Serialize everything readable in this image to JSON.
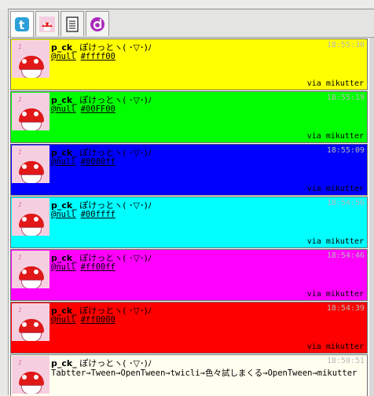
{
  "tabs": [
    {
      "name": "twitter-tab",
      "icon": "twitter-icon",
      "color": "#2a9fd8",
      "active": true
    },
    {
      "name": "mentions-tab",
      "icon": "avatar-icon",
      "color": "#cc2222",
      "active": false
    },
    {
      "name": "list-tab",
      "icon": "notepad-icon",
      "color": "#444444",
      "active": false
    },
    {
      "name": "activity-tab",
      "icon": "d-icon",
      "color": "#aa2bbb",
      "active": false
    }
  ],
  "tweets": [
    {
      "screen_name": "p_ck_",
      "display_name": "ぽけっとヽ( ･▽･)ﾉ",
      "time": "18:55:30",
      "mention": "@null",
      "tag": "#ffff00",
      "bg": "#ffff00",
      "via": "via mikutter"
    },
    {
      "screen_name": "p_ck_",
      "display_name": "ぽけっとヽ( ･▽･)ﾉ",
      "time": "18:55:19",
      "mention": "@null",
      "tag": "#00FF00",
      "bg": "#00ff00",
      "via": "via mikutter"
    },
    {
      "screen_name": "p_ck_",
      "display_name": "ぽけっとヽ( ･▽･)ﾉ",
      "time": "18:55:09",
      "mention": "@null",
      "tag": "#0000ff",
      "bg": "#0000ff",
      "via": "via mikutter"
    },
    {
      "screen_name": "p_ck_",
      "display_name": "ぽけっとヽ( ･▽･)ﾉ",
      "time": "18:54:56",
      "mention": "@null",
      "tag": "#00ffff",
      "bg": "#00ffff",
      "via": "via mikutter"
    },
    {
      "screen_name": "p_ck_",
      "display_name": "ぽけっとヽ( ･▽･)ﾉ",
      "time": "18:54:46",
      "mention": "@null",
      "tag": "#ff00ff",
      "bg": "#ff00ff",
      "via": "via mikutter"
    },
    {
      "screen_name": "p_ck_",
      "display_name": "ぽけっとヽ( ･▽･)ﾉ",
      "time": "18:54:39",
      "mention": "@null",
      "tag": "#ff0000",
      "bg": "#ff0000",
      "via": "via mikutter"
    }
  ],
  "last_tweet": {
    "screen_name": "p_ck_",
    "display_name": "ぽけっとヽ( ･▽･)ﾉ",
    "time": "18:50:51",
    "text": "Tabtter→Tween→OpenTween→twicli→色々試しまくる→OpenTween→mikutter",
    "bg": "#fffff0"
  }
}
